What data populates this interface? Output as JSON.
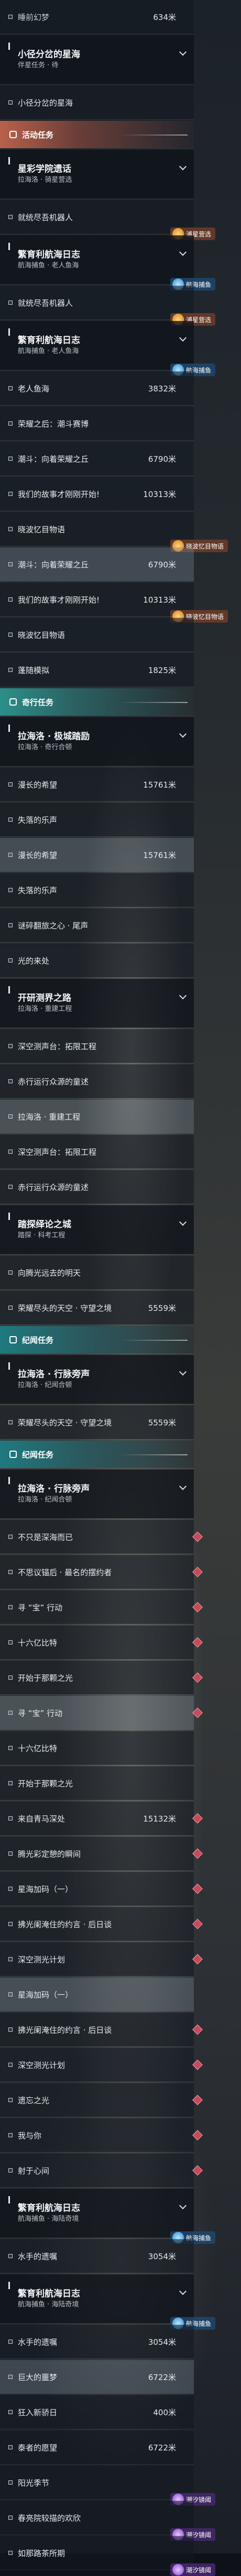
{
  "colors": {
    "orange_header": "#b8614b",
    "green_header": "#2c8f8a",
    "red_marker": "#c64a5a"
  },
  "icons": {
    "objective": "square-bullet-icon",
    "collapse": "chevron-down-icon",
    "header": "quest-category-icon",
    "marker": "waypoint-diamond-icon"
  },
  "rows": [
    {
      "type": "obj",
      "text": "睡前幻梦",
      "dist": "634米",
      "state": "done"
    },
    {
      "type": "quest",
      "title": "小径分岔的星海",
      "sub": "伴星任务 · 待"
    },
    {
      "type": "obj",
      "text": "小径分岔的星海"
    },
    {
      "type": "head",
      "style": "orange",
      "text": "活动任务"
    },
    {
      "type": "quest",
      "title": "星彩学院遗话",
      "sub": "拉海洛 · 骑星营选"
    },
    {
      "type": "obj",
      "text": "就统尽吾机器人",
      "tag": {
        "style": "orange",
        "text": "浦星营选"
      }
    },
    {
      "type": "quest",
      "title": "繁育利航海日志",
      "sub": "航海捕鱼 · 老人鱼海",
      "tag": {
        "style": "blue",
        "text": "航海捕鱼"
      }
    },
    {
      "type": "obj",
      "text": "就统尽吾机器人",
      "tag": {
        "style": "orange",
        "text": "浦星营选"
      }
    },
    {
      "type": "quest",
      "title": "繁育利航海日志",
      "sub": "航海捕鱼 · 老人鱼海",
      "tag": {
        "style": "blue",
        "text": "航海捕鱼"
      }
    },
    {
      "type": "obj",
      "text": "老人鱼海",
      "dist": "3832米"
    },
    {
      "type": "obj",
      "text": "荣耀之后：潮斗赛博"
    },
    {
      "type": "obj",
      "text": "潮斗：向着荣耀之丘",
      "dist": "6790米"
    },
    {
      "type": "obj",
      "text": "我们的故事才刚刚开始!",
      "dist": "10313米"
    },
    {
      "type": "obj",
      "text": "晓波忆目物语",
      "tag": {
        "style": "orange",
        "text": "晓波忆目物语"
      }
    },
    {
      "type": "obj",
      "text": "潮斗：向着荣耀之丘",
      "dist": "6790米",
      "state": "partial"
    },
    {
      "type": "obj",
      "text": "我们的故事才刚刚开始!",
      "dist": "10313米",
      "tag": {
        "style": "orange",
        "text": "晓波忆目物语"
      }
    },
    {
      "type": "obj",
      "text": "晓波忆目物语"
    },
    {
      "type": "obj",
      "text": "蓬随模拟",
      "dist": "1825米"
    },
    {
      "type": "head",
      "style": "green",
      "text": "奇行任务"
    },
    {
      "type": "quest",
      "title": "拉海洛 · 极城踏励",
      "sub": "拉海洛 · 奇行合顿"
    },
    {
      "type": "obj",
      "text": "漫长的希望",
      "dist": "15761米"
    },
    {
      "type": "obj",
      "text": "失落的乐声"
    },
    {
      "type": "obj",
      "text": "漫长的希望",
      "dist": "15761米",
      "state": "partial"
    },
    {
      "type": "obj",
      "text": "失落的乐声"
    },
    {
      "type": "obj",
      "text": "谜碎翻旅之心 · 尾声"
    },
    {
      "type": "obj",
      "text": "光的来处"
    },
    {
      "type": "quest",
      "title": "开研测界之路",
      "sub": "拉海洛 · 重建工程"
    },
    {
      "type": "obj",
      "text": "深空测声台：拓限工程"
    },
    {
      "type": "obj",
      "text": "赤行运行众源的童述"
    },
    {
      "type": "obj",
      "text": "拉海洛 · 重建工程",
      "state": "partial"
    },
    {
      "type": "obj",
      "text": "深空测声台：拓限工程"
    },
    {
      "type": "obj",
      "text": "赤行运行众源的童述"
    },
    {
      "type": "quest",
      "title": "踏探绎论之城",
      "sub": "踏探 · 科考工程"
    },
    {
      "type": "obj",
      "text": "向腾光远去的明天"
    },
    {
      "type": "obj",
      "text": "荣耀尽头的天空 · 守望之境",
      "dist": "5559米"
    },
    {
      "type": "head",
      "style": "teal",
      "text": "纪闻任务"
    },
    {
      "type": "quest",
      "title": "拉海洛 · 行脉旁声",
      "sub": "拉海洛 · 纪闻合顿"
    },
    {
      "type": "obj",
      "text": "荣耀尽头的天空 · 守望之境",
      "dist": "5559米"
    },
    {
      "type": "head",
      "style": "teal",
      "text": "纪闻任务"
    },
    {
      "type": "quest",
      "title": "拉海洛 · 行脉旁声",
      "sub": "拉海洛 · 纪闻合顿"
    },
    {
      "type": "obj",
      "text": "不只是深海而已",
      "marker": true
    },
    {
      "type": "obj",
      "text": "不思议锚后 · 最名的摆约者",
      "marker": true
    },
    {
      "type": "obj",
      "text": "寻 “宝” 行动",
      "marker": true
    },
    {
      "type": "obj",
      "text": "十六亿比特",
      "marker": true
    },
    {
      "type": "obj",
      "text": "开始于那颗之光",
      "marker": true
    },
    {
      "type": "obj",
      "text": "寻 “宝” 行动",
      "state": "partial",
      "marker": true
    },
    {
      "type": "obj",
      "text": "十六亿比特"
    },
    {
      "type": "obj",
      "text": "开始于那颗之光"
    },
    {
      "type": "obj",
      "text": "来自青马深处",
      "dist": "15132米",
      "marker": true
    },
    {
      "type": "obj",
      "text": "腾光彩定憩的瞬间",
      "marker": true
    },
    {
      "type": "obj",
      "text": "星海加码（一）",
      "marker": true
    },
    {
      "type": "obj",
      "text": "拂光阑淹住的约言 · 后日谈",
      "marker": true
    },
    {
      "type": "obj",
      "text": "深空测光计划",
      "marker": true
    },
    {
      "type": "obj",
      "text": "星海加码（一）",
      "state": "partial"
    },
    {
      "type": "obj",
      "text": "拂光阑淹住的约言 · 后日谈",
      "marker": true
    },
    {
      "type": "obj",
      "text": "深空测光计划",
      "marker": true
    },
    {
      "type": "obj",
      "text": "遗忘之光",
      "marker": true
    },
    {
      "type": "obj",
      "text": "我与你",
      "marker": true
    },
    {
      "type": "obj",
      "text": "射于心间",
      "marker": true
    },
    {
      "type": "quest",
      "title": "繁育利航海日志",
      "sub": "航海捕鱼 · 海陆奇境",
      "tag": {
        "style": "blue",
        "text": "航海捕鱼"
      }
    },
    {
      "type": "obj",
      "text": "水手的遗嘱",
      "dist": "3054米"
    },
    {
      "type": "quest",
      "title": "繁育利航海日志",
      "sub": "航海捕鱼 · 海陆奇境",
      "tag": {
        "style": "blue",
        "text": "航海捕鱼"
      }
    },
    {
      "type": "obj",
      "text": "水手的遗嘱",
      "dist": "3054米"
    },
    {
      "type": "obj",
      "text": "巨大的噩梦",
      "dist": "6722米",
      "state": "partial"
    },
    {
      "type": "obj",
      "text": "狂入新骄日",
      "dist": "400米"
    },
    {
      "type": "obj",
      "text": "泰者的愿望",
      "dist": "6722米"
    },
    {
      "type": "obj",
      "text": "阳光季节",
      "tag": {
        "style": "purple",
        "text": "潮汐镜阈"
      }
    },
    {
      "type": "obj",
      "text": "春亮院较描的欢欣",
      "tag": {
        "style": "purple",
        "text": "潮汐镜阈"
      }
    },
    {
      "type": "obj",
      "text": "如那路茶所期",
      "tag": {
        "style": "purple",
        "text": "潮汐镜阈"
      }
    }
  ]
}
